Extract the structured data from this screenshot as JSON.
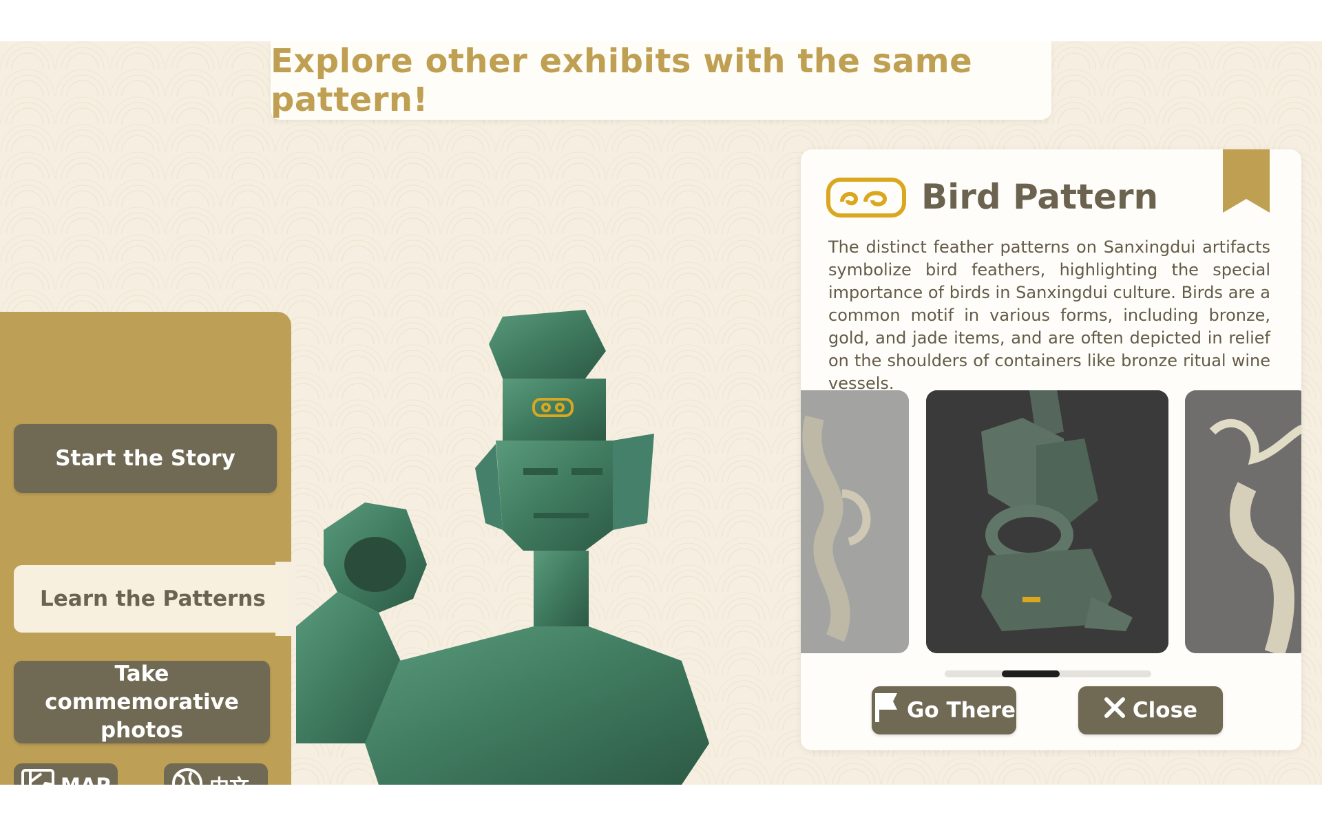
{
  "banner": {
    "title": "Explore other exhibits with the same pattern!"
  },
  "menu": {
    "start_story": "Start the Story",
    "learn_patterns": "Learn the Patterns",
    "take_photos": "Take commemorative photos",
    "map_label": "MAP",
    "language_label": "中文"
  },
  "card": {
    "title": "Bird Pattern",
    "description": "The distinct feather patterns on Sanxingdui artifacts symbolize bird feathers, highlighting the special importance of birds in Sanxingdui culture. Birds are a common motif in various forms, including bronze, gold, and jade items, and are often depicted in relief on the shoulders of containers like bronze ritual wine vessels.",
    "go_there_label": "Go There",
    "close_label": "Close",
    "carousel": {
      "active_index": 1,
      "count": 3
    }
  },
  "colors": {
    "accent_gold": "#bf9f52",
    "menu_gold": "#bd9f55",
    "button_dark": "#706953",
    "pattern_yellow": "#d9a820",
    "background": "#f6efe1"
  },
  "icons": {
    "pattern": "bird-pattern-icon",
    "bookmark": "bookmark-icon",
    "map": "map-icon",
    "language": "language-icon",
    "flag": "flag-icon",
    "close": "close-icon"
  }
}
